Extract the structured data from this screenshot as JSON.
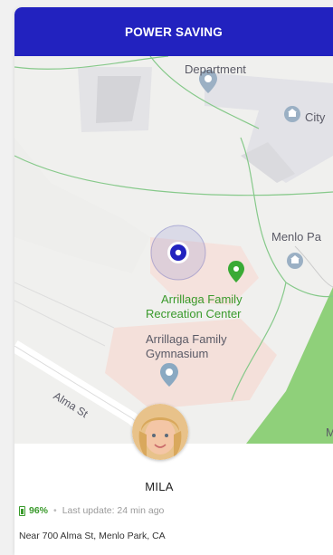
{
  "banner": {
    "label": "POWER SAVING",
    "color": "#2222bf"
  },
  "map": {
    "labels": {
      "department": "Department",
      "city": "City",
      "menlo": "Menlo Pa",
      "arrillaga_rec_1": "Arrillaga Family",
      "arrillaga_rec_2": "Recreation Center",
      "arrillaga_gym_1": "Arrillaga Family",
      "arrillaga_gym_2": "Gymnasium",
      "street": "Alma St",
      "edge": "M"
    },
    "icons": [
      "location-pin-icon",
      "bank-icon",
      "place-pin-icon",
      "current-location-icon"
    ]
  },
  "profile": {
    "name": "MILA",
    "battery": "96%",
    "separator": "•",
    "last_update": "Last update: 24 min ago",
    "location": "Near 700 Alma St, Menlo Park, CA"
  },
  "colors": {
    "accent": "#2222bf",
    "battery": "#3a9a2c",
    "park": "#8fd07a"
  }
}
